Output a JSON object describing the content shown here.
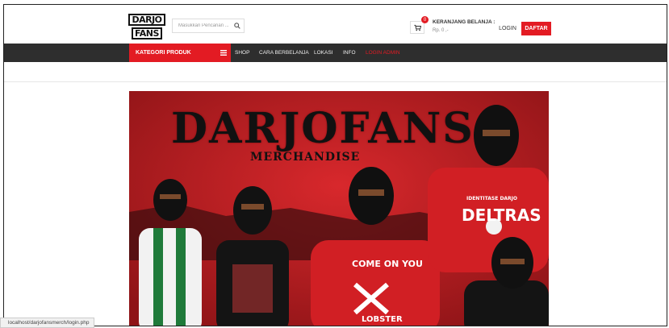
{
  "header": {
    "logo_line1": "DARJO",
    "logo_line2": "FANS",
    "search_placeholder": "Masukkan Pencarian ...",
    "cart_count": "0",
    "cart_label": "KERANJANG BELANJA :",
    "cart_amount": "Rp. 0 ,-",
    "login_label": "LOGIN",
    "register_label": "DAFTAR"
  },
  "nav": {
    "category_label": "KATEGORI PRODUK",
    "items": [
      "SHOP",
      "CARA BERBELANJA",
      "LOKASI",
      "INFO",
      "LOGIN ADMIN"
    ]
  },
  "banner": {
    "title": "DARJOFANS",
    "subtitle": "MERCHANDISE",
    "shirt_text_1": "COME ON YOU",
    "shirt_text_2": "LOBSTER",
    "shirt_text_3": "DELTRAS",
    "shirt_text_4": "IDENTITASE DARJO"
  },
  "status_bar": {
    "url": "localhost/darjofansmerch/login.php"
  },
  "colors": {
    "accent": "#e31b23",
    "navbar": "#2e2e2e",
    "banner_bg": "#b51e22"
  }
}
